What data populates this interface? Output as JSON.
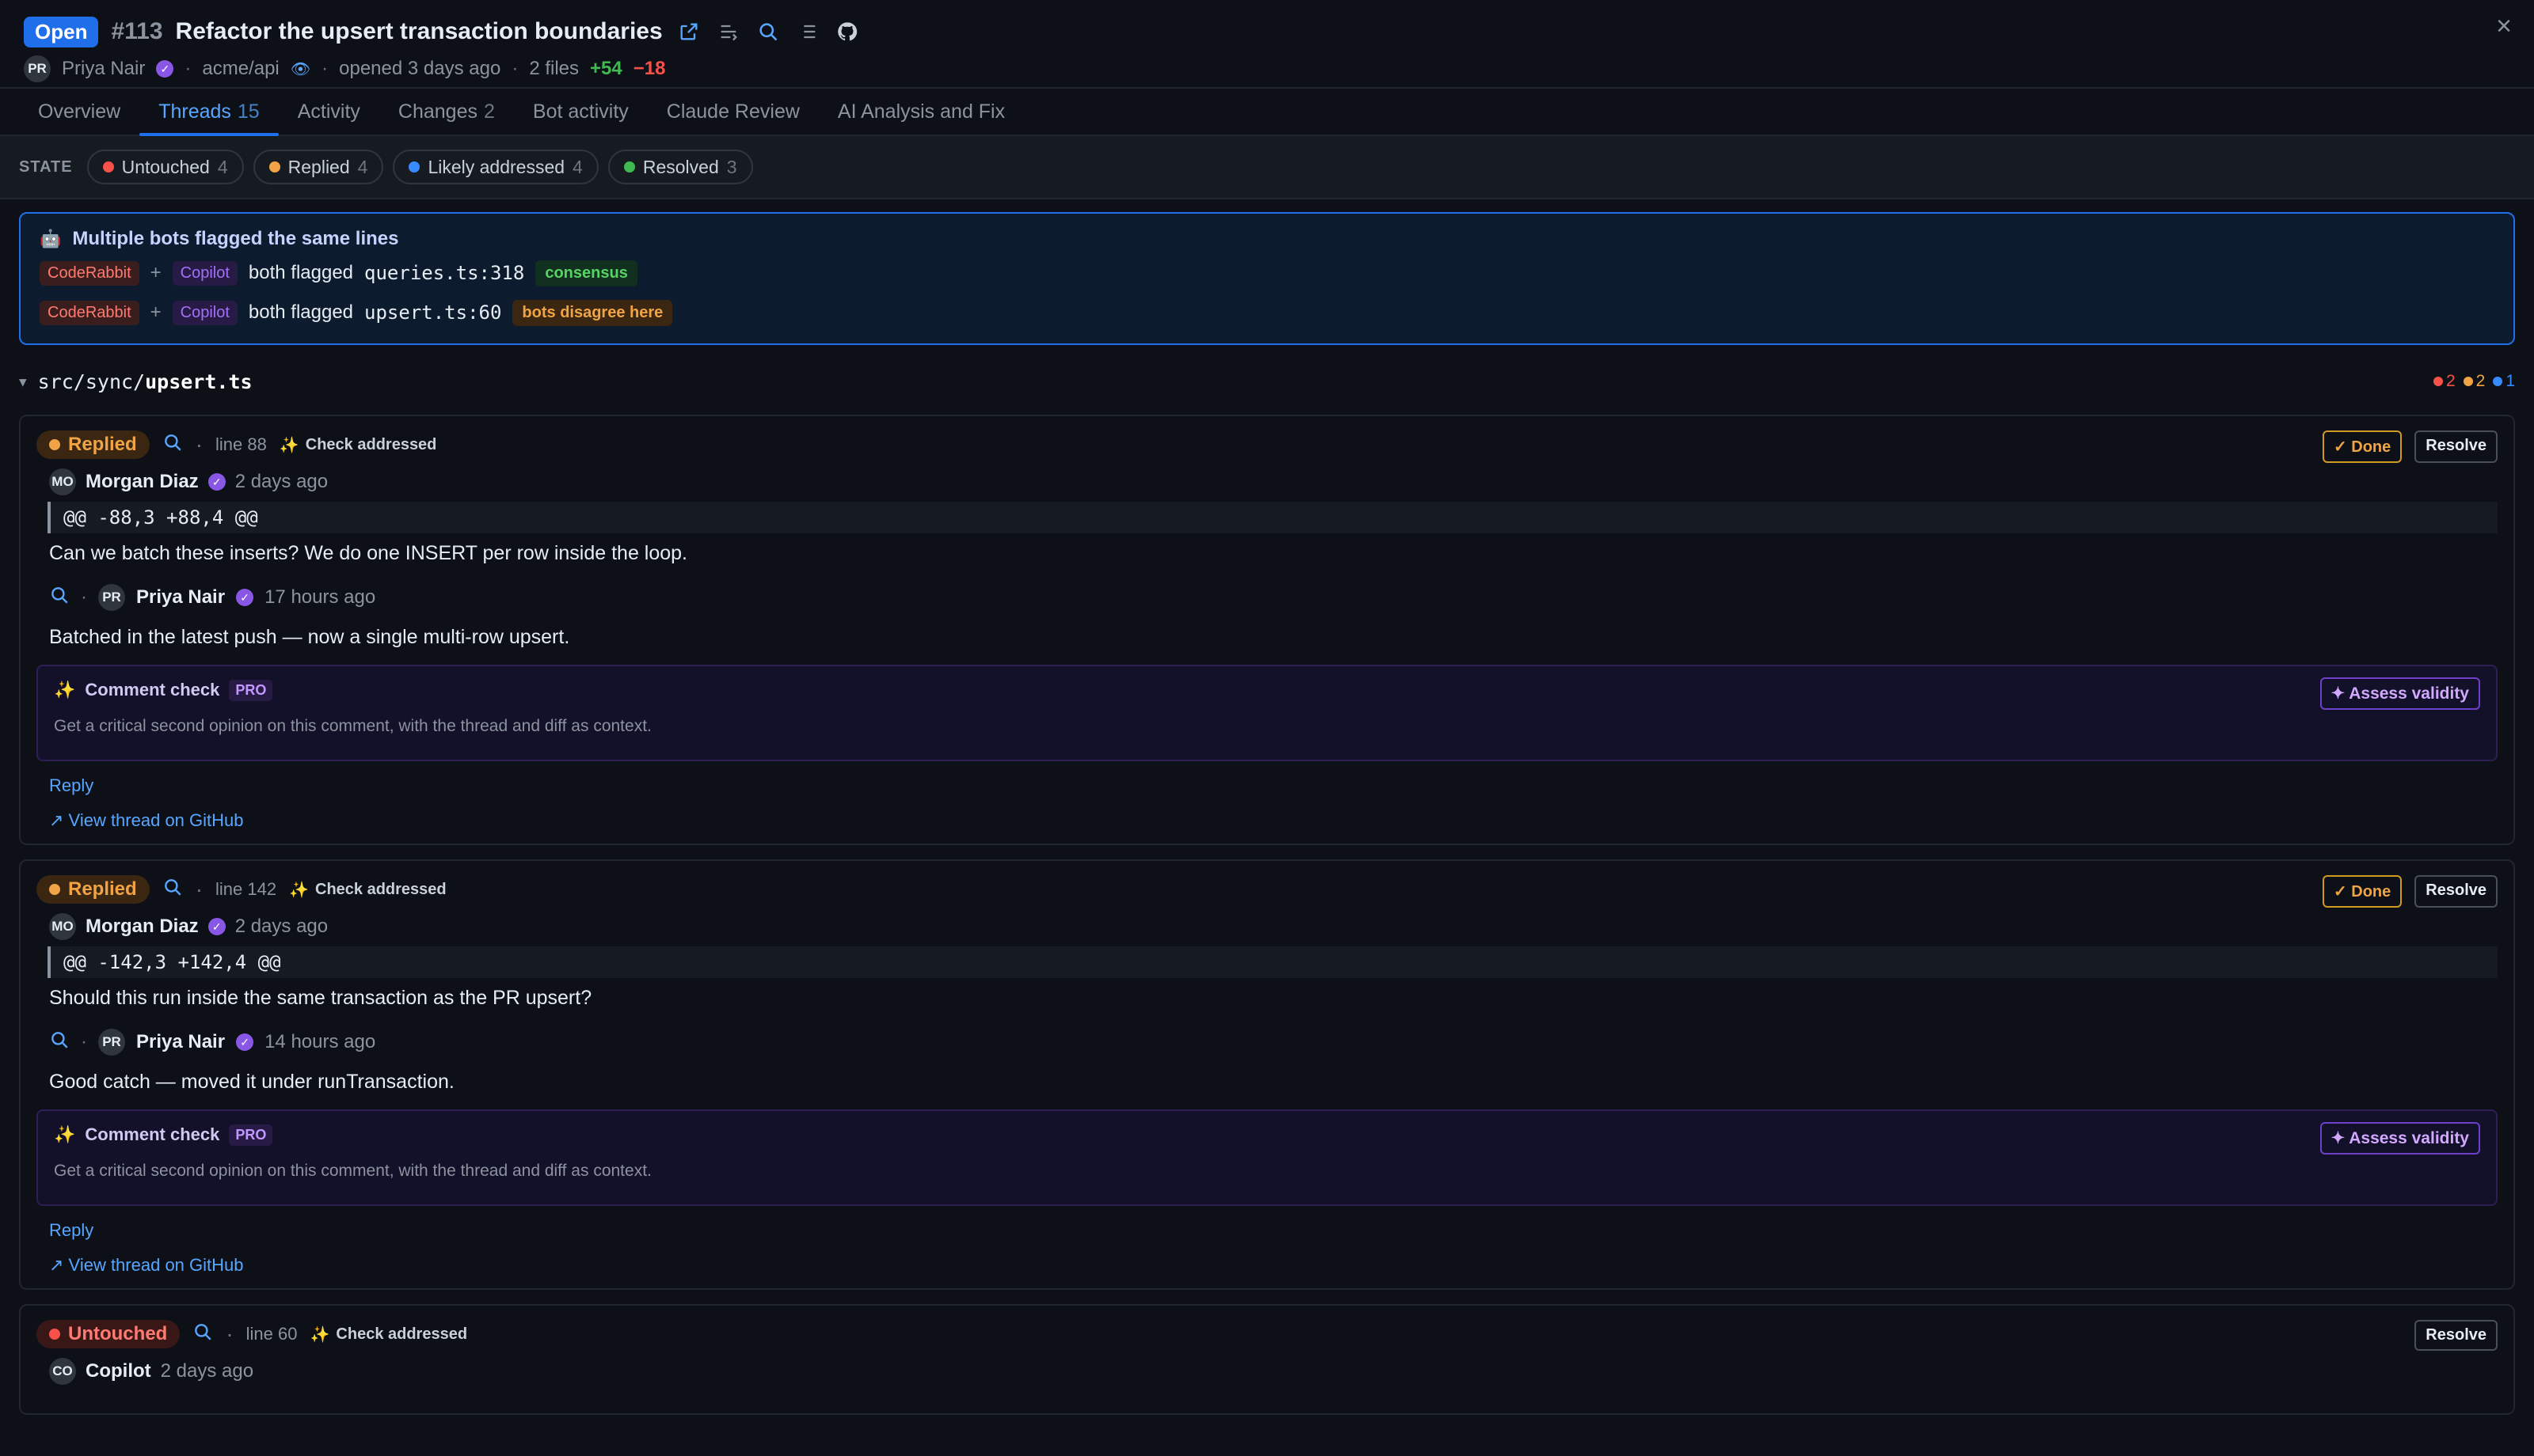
{
  "header": {
    "state": "Open",
    "number": "#113",
    "title": "Refactor the upsert transaction boundaries",
    "author_initials": "PR",
    "author": "Priya Nair",
    "repo": "acme/api",
    "opened": "opened 3 days ago",
    "files": "2 files",
    "additions": "+54",
    "deletions": "−18",
    "close": "×"
  },
  "tabs": [
    {
      "label": "Overview",
      "count": ""
    },
    {
      "label": "Threads",
      "count": "15"
    },
    {
      "label": "Activity",
      "count": ""
    },
    {
      "label": "Changes",
      "count": "2"
    },
    {
      "label": "Bot activity",
      "count": ""
    },
    {
      "label": "Claude Review",
      "count": ""
    },
    {
      "label": "AI Analysis and Fix",
      "count": ""
    }
  ],
  "state_filter": {
    "label": "STATE",
    "chips": [
      {
        "label": "Untouched",
        "count": "4",
        "color": "#f85149"
      },
      {
        "label": "Replied",
        "count": "4",
        "color": "#f0a446"
      },
      {
        "label": "Likely addressed",
        "count": "4",
        "color": "#388bfd"
      },
      {
        "label": "Resolved",
        "count": "3",
        "color": "#3fb950"
      }
    ]
  },
  "bots_flag": {
    "title": "Multiple bots flagged the same lines",
    "rows": [
      {
        "bot1": "CodeRabbit",
        "plus": "+",
        "bot2": "Copilot",
        "text": "both flagged",
        "file": "queries.ts:318",
        "badge": "consensus"
      },
      {
        "bot1": "CodeRabbit",
        "plus": "+",
        "bot2": "Copilot",
        "text": "both flagged",
        "file": "upsert.ts:60",
        "badge": "bots disagree here"
      }
    ]
  },
  "file": {
    "dir": "src/sync/",
    "name": "upsert.ts",
    "count_red": "2",
    "count_orange": "2",
    "count_blue": "1"
  },
  "threads": [
    {
      "state": "Replied",
      "line": "line 88",
      "check": "Check addressed",
      "done": "✓ Done",
      "resolve": "Resolve",
      "author_initials": "MO",
      "author": "Morgan Diaz",
      "time": "2 days ago",
      "hunk": "@@ -88,3 +88,4 @@",
      "body": "Can we batch these inserts? We do one INSERT per row inside the loop.",
      "reply_initials": "PR",
      "reply_author": "Priya Nair",
      "reply_time": "17 hours ago",
      "reply_body": "Batched in the latest push — now a single multi-row upsert.",
      "check_title": "Comment check",
      "pro": "PRO",
      "check_desc": "Get a critical second opinion on this comment, with the thread and diff as context.",
      "assess": "✦ Assess validity",
      "reply_link": "Reply",
      "gh_link": "↗ View thread on GitHub"
    },
    {
      "state": "Replied",
      "line": "line 142",
      "check": "Check addressed",
      "done": "✓ Done",
      "resolve": "Resolve",
      "author_initials": "MO",
      "author": "Morgan Diaz",
      "time": "2 days ago",
      "hunk": "@@ -142,3 +142,4 @@",
      "body": "Should this run inside the same transaction as the PR upsert?",
      "reply_initials": "PR",
      "reply_author": "Priya Nair",
      "reply_time": "14 hours ago",
      "reply_body": "Good catch — moved it under runTransaction.",
      "check_title": "Comment check",
      "pro": "PRO",
      "check_desc": "Get a critical second opinion on this comment, with the thread and diff as context.",
      "assess": "✦ Assess validity",
      "reply_link": "Reply",
      "gh_link": "↗ View thread on GitHub"
    },
    {
      "state": "Untouched",
      "line": "line 60",
      "check": "Check addressed",
      "resolve": "Resolve",
      "author_initials": "CO",
      "author": "Copilot",
      "time": "2 days ago"
    }
  ]
}
